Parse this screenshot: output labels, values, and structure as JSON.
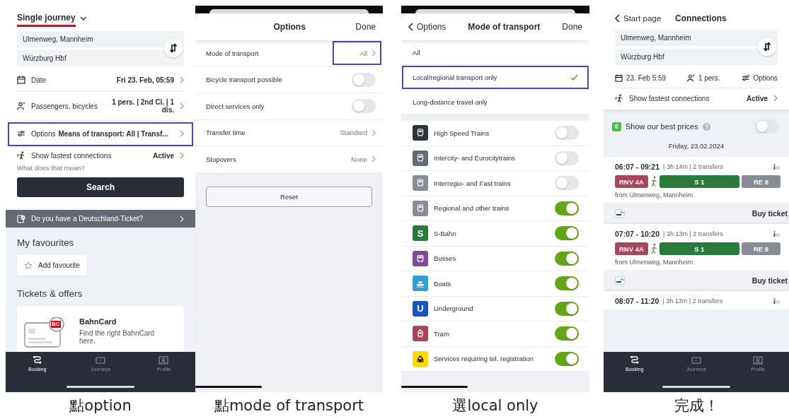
{
  "start": {
    "journey_type": "Single journey",
    "from": "Ulmenweg, Mannheim",
    "to": "Würzburg Hbf",
    "rows": [
      {
        "kind": "date",
        "label": "Date",
        "value": "Fri 23. Feb, 05:59",
        "highlighted": false
      },
      {
        "kind": "passengers",
        "label": "Passengers, bicycles",
        "value": "1 pers. | 2nd Cl. | 1 dis.",
        "highlighted": false
      },
      {
        "kind": "options",
        "label": "Options",
        "value": "Means of transport: All | Transf...",
        "highlighted": true
      }
    ],
    "fastest": {
      "label": "Show fastest connections",
      "value": "Active",
      "hint": "What does that mean?"
    },
    "search_button": "Search",
    "banner": "Do you have a Deutschland-Ticket?",
    "favourites_title": "My favourites",
    "add_favourite": "Add favourite",
    "tickets_title": "Tickets & offers",
    "card": {
      "badge": "BC",
      "title": "BahnCard",
      "text": "Find the right BahnCard here."
    },
    "nav": [
      {
        "kind": "booking",
        "label": "Booking",
        "selected": true
      },
      {
        "kind": "journeys",
        "label": "Journeys",
        "selected": false
      },
      {
        "kind": "profile",
        "label": "Profile",
        "selected": false
      }
    ],
    "caption": "點option"
  },
  "options": {
    "title": "Options",
    "done": "Done",
    "rows": [
      {
        "kind": "link",
        "label": "Mode of transport",
        "value": "All",
        "highlighted": true
      },
      {
        "kind": "toggle",
        "label": "Bicycle transport possible",
        "on": false
      },
      {
        "kind": "toggle",
        "label": "Direct services only",
        "on": false
      },
      {
        "kind": "link",
        "label": "Transfer time",
        "value": "Standard",
        "highlighted": false
      },
      {
        "kind": "link",
        "label": "Stopovers",
        "value": "None",
        "highlighted": false
      }
    ],
    "reset": "Reset",
    "caption": "點mode of transport"
  },
  "mode": {
    "back": "Options",
    "title": "Mode of transport",
    "done": "Done",
    "choices": [
      {
        "label": "All",
        "selected": false,
        "highlighted": false
      },
      {
        "label": "Local/regional transport only",
        "selected": true,
        "highlighted": true
      },
      {
        "label": "Long-distance travel only",
        "selected": false,
        "highlighted": false
      }
    ],
    "modes": [
      {
        "kind": "train",
        "label": "High Speed Trains",
        "color": "#2d323d",
        "on": false
      },
      {
        "kind": "train",
        "label": "Intercity- and Eurocitytrains",
        "color": "#646973",
        "on": false
      },
      {
        "kind": "train",
        "label": "Interregio- and Fast trains",
        "color": "#878c96",
        "on": false
      },
      {
        "kind": "train",
        "label": "Regional and other trains",
        "color": "#878c96",
        "on": true
      },
      {
        "kind": "letter",
        "letter": "S",
        "label": "S-Bahn",
        "color": "#2b7a3b",
        "on": true
      },
      {
        "kind": "bus",
        "label": "Busses",
        "color": "#814997",
        "on": true
      },
      {
        "kind": "boat",
        "label": "Boats",
        "color": "#309fd1",
        "on": true
      },
      {
        "kind": "letter",
        "letter": "U",
        "label": "Underground",
        "color": "#1455c0",
        "on": true
      },
      {
        "kind": "tram",
        "label": "Tram",
        "color": "#a9455d",
        "on": true
      },
      {
        "kind": "taxi",
        "label": "Services requiring tel. registration",
        "color": "#ffd800",
        "on": true
      }
    ],
    "caption": "選local only"
  },
  "connections": {
    "back": "Start page",
    "title": "Connections",
    "from": "Ulmenweg, Mannheim",
    "to": "Würzburg Hbf",
    "date": "23. Feb 5:59",
    "persons": "1 pers.",
    "options": "Options",
    "fastest": {
      "label": "Show fastest connections",
      "value": "Active"
    },
    "best_prices": {
      "badge": "€",
      "label": "Show our best prices",
      "on": false
    },
    "date_heading": "Friday, 23.02.2024",
    "journeys": [
      {
        "time": "06:07 - 09:21",
        "info": "| 3h 14m | 2 transfers",
        "legs": [
          {
            "kind": "line",
            "label": "RNV 4A",
            "color": "#a9455d"
          },
          {
            "kind": "walk"
          },
          {
            "kind": "line",
            "label": "S 1",
            "color": "#2b7a3b"
          },
          {
            "kind": "line",
            "label": "RE 8",
            "color": "#878c96"
          }
        ],
        "origin": "from Ulmenweg, Mannheim",
        "buy": "Buy ticket"
      },
      {
        "time": "07:07 - 10:20",
        "info": "| 3h 13m | 2 transfers",
        "legs": [
          {
            "kind": "line",
            "label": "RNV 4A",
            "color": "#a9455d"
          },
          {
            "kind": "walk"
          },
          {
            "kind": "line",
            "label": "S 1",
            "color": "#2b7a3b"
          },
          {
            "kind": "line",
            "label": "RE 8",
            "color": "#878c96"
          }
        ],
        "origin": "from Ulmenweg, Mannheim",
        "buy": "Buy ticket"
      },
      {
        "time": "08:07 - 11:20",
        "info": "| 3h 13m | 2 transfers"
      }
    ],
    "nav": [
      {
        "kind": "booking",
        "label": "Booking",
        "selected": true
      },
      {
        "kind": "journeys",
        "label": "Journeys",
        "selected": false
      },
      {
        "kind": "profile",
        "label": "Profile",
        "selected": false
      }
    ],
    "caption": "完成！"
  }
}
